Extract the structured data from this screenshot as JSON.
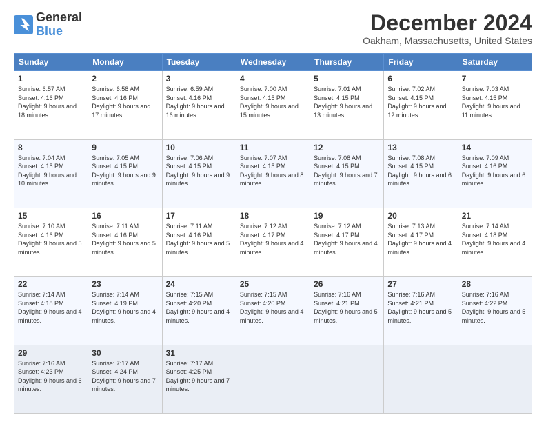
{
  "logo": {
    "text_general": "General",
    "text_blue": "Blue"
  },
  "title": "December 2024",
  "subtitle": "Oakham, Massachusetts, United States",
  "days_of_week": [
    "Sunday",
    "Monday",
    "Tuesday",
    "Wednesday",
    "Thursday",
    "Friday",
    "Saturday"
  ],
  "weeks": [
    [
      {
        "day": "1",
        "sunrise": "6:57 AM",
        "sunset": "4:16 PM",
        "daylight": "9 hours and 18 minutes."
      },
      {
        "day": "2",
        "sunrise": "6:58 AM",
        "sunset": "4:16 PM",
        "daylight": "9 hours and 17 minutes."
      },
      {
        "day": "3",
        "sunrise": "6:59 AM",
        "sunset": "4:16 PM",
        "daylight": "9 hours and 16 minutes."
      },
      {
        "day": "4",
        "sunrise": "7:00 AM",
        "sunset": "4:15 PM",
        "daylight": "9 hours and 15 minutes."
      },
      {
        "day": "5",
        "sunrise": "7:01 AM",
        "sunset": "4:15 PM",
        "daylight": "9 hours and 13 minutes."
      },
      {
        "day": "6",
        "sunrise": "7:02 AM",
        "sunset": "4:15 PM",
        "daylight": "9 hours and 12 minutes."
      },
      {
        "day": "7",
        "sunrise": "7:03 AM",
        "sunset": "4:15 PM",
        "daylight": "9 hours and 11 minutes."
      }
    ],
    [
      {
        "day": "8",
        "sunrise": "7:04 AM",
        "sunset": "4:15 PM",
        "daylight": "9 hours and 10 minutes."
      },
      {
        "day": "9",
        "sunrise": "7:05 AM",
        "sunset": "4:15 PM",
        "daylight": "9 hours and 9 minutes."
      },
      {
        "day": "10",
        "sunrise": "7:06 AM",
        "sunset": "4:15 PM",
        "daylight": "9 hours and 9 minutes."
      },
      {
        "day": "11",
        "sunrise": "7:07 AM",
        "sunset": "4:15 PM",
        "daylight": "9 hours and 8 minutes."
      },
      {
        "day": "12",
        "sunrise": "7:08 AM",
        "sunset": "4:15 PM",
        "daylight": "9 hours and 7 minutes."
      },
      {
        "day": "13",
        "sunrise": "7:08 AM",
        "sunset": "4:15 PM",
        "daylight": "9 hours and 6 minutes."
      },
      {
        "day": "14",
        "sunrise": "7:09 AM",
        "sunset": "4:16 PM",
        "daylight": "9 hours and 6 minutes."
      }
    ],
    [
      {
        "day": "15",
        "sunrise": "7:10 AM",
        "sunset": "4:16 PM",
        "daylight": "9 hours and 5 minutes."
      },
      {
        "day": "16",
        "sunrise": "7:11 AM",
        "sunset": "4:16 PM",
        "daylight": "9 hours and 5 minutes."
      },
      {
        "day": "17",
        "sunrise": "7:11 AM",
        "sunset": "4:16 PM",
        "daylight": "9 hours and 5 minutes."
      },
      {
        "day": "18",
        "sunrise": "7:12 AM",
        "sunset": "4:17 PM",
        "daylight": "9 hours and 4 minutes."
      },
      {
        "day": "19",
        "sunrise": "7:12 AM",
        "sunset": "4:17 PM",
        "daylight": "9 hours and 4 minutes."
      },
      {
        "day": "20",
        "sunrise": "7:13 AM",
        "sunset": "4:17 PM",
        "daylight": "9 hours and 4 minutes."
      },
      {
        "day": "21",
        "sunrise": "7:14 AM",
        "sunset": "4:18 PM",
        "daylight": "9 hours and 4 minutes."
      }
    ],
    [
      {
        "day": "22",
        "sunrise": "7:14 AM",
        "sunset": "4:18 PM",
        "daylight": "9 hours and 4 minutes."
      },
      {
        "day": "23",
        "sunrise": "7:14 AM",
        "sunset": "4:19 PM",
        "daylight": "9 hours and 4 minutes."
      },
      {
        "day": "24",
        "sunrise": "7:15 AM",
        "sunset": "4:20 PM",
        "daylight": "9 hours and 4 minutes."
      },
      {
        "day": "25",
        "sunrise": "7:15 AM",
        "sunset": "4:20 PM",
        "daylight": "9 hours and 4 minutes."
      },
      {
        "day": "26",
        "sunrise": "7:16 AM",
        "sunset": "4:21 PM",
        "daylight": "9 hours and 5 minutes."
      },
      {
        "day": "27",
        "sunrise": "7:16 AM",
        "sunset": "4:21 PM",
        "daylight": "9 hours and 5 minutes."
      },
      {
        "day": "28",
        "sunrise": "7:16 AM",
        "sunset": "4:22 PM",
        "daylight": "9 hours and 5 minutes."
      }
    ],
    [
      {
        "day": "29",
        "sunrise": "7:16 AM",
        "sunset": "4:23 PM",
        "daylight": "9 hours and 6 minutes."
      },
      {
        "day": "30",
        "sunrise": "7:17 AM",
        "sunset": "4:24 PM",
        "daylight": "9 hours and 7 minutes."
      },
      {
        "day": "31",
        "sunrise": "7:17 AM",
        "sunset": "4:25 PM",
        "daylight": "9 hours and 7 minutes."
      },
      null,
      null,
      null,
      null
    ]
  ]
}
